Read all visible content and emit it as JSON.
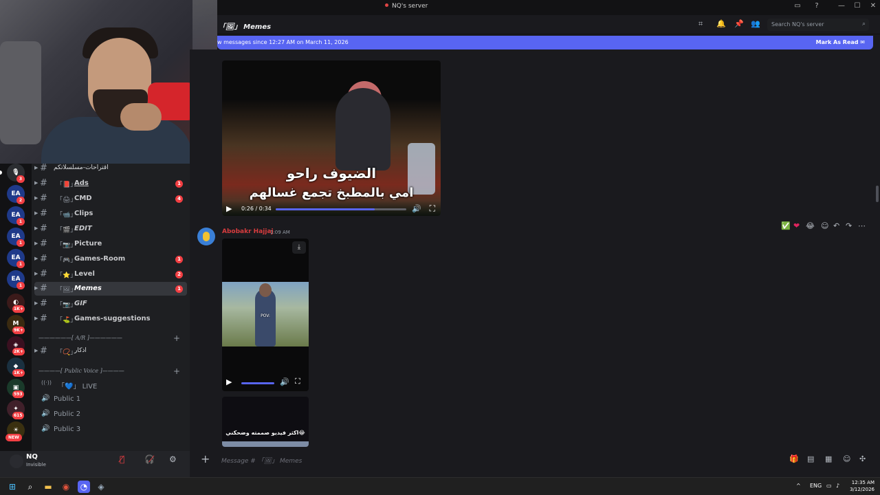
{
  "window": {
    "title": "NQ's server",
    "controls": [
      "—",
      "☐",
      "✕"
    ],
    "icons": [
      "screen-share-icon",
      "help-icon"
    ]
  },
  "servers": [
    {
      "label": "🎙",
      "badge": "3",
      "active": true
    },
    {
      "label": "EA",
      "badge": "2"
    },
    {
      "label": "EA",
      "badge": "1"
    },
    {
      "label": "EA",
      "badge": "1"
    },
    {
      "label": "EA",
      "badge": "1"
    },
    {
      "label": "EA",
      "badge": "1"
    },
    {
      "label": "◐",
      "badge": "1K+"
    },
    {
      "label": "M",
      "badge": "9K+"
    },
    {
      "label": "◈",
      "badge": "2K+"
    },
    {
      "label": "◆",
      "badge": "1K+"
    },
    {
      "label": "▣",
      "badge": "593"
    },
    {
      "label": "✦",
      "badge": "615"
    },
    {
      "label": "☀",
      "badge": "NEW"
    }
  ],
  "channels": [
    {
      "emoji": "",
      "name": "اقتراحات-مسلسلاتكم",
      "badge": "",
      "italic": false
    },
    {
      "emoji": "「📕」",
      "name": "Ads",
      "badge": "1",
      "italic": false
    },
    {
      "emoji": "「🖨」",
      "name": "CMD",
      "badge": "4",
      "italic": false
    },
    {
      "emoji": "「📹」",
      "name": "Clips",
      "badge": "",
      "italic": false
    },
    {
      "emoji": "「🎬」",
      "name": "EDIT",
      "badge": "",
      "italic": true
    },
    {
      "emoji": "「📷」",
      "name": "Picture",
      "badge": "",
      "italic": false
    },
    {
      "emoji": "「🎮」",
      "name": "Games-Room",
      "badge": "1",
      "italic": false
    },
    {
      "emoji": "「⭐」",
      "name": "Level",
      "badge": "2",
      "italic": false
    },
    {
      "emoji": "「🖼」",
      "name": "Memes",
      "badge": "1",
      "italic": true,
      "active": true
    },
    {
      "emoji": "「📷」",
      "name": "GIF",
      "badge": "",
      "italic": true
    },
    {
      "emoji": "「⛳」",
      "name": "Games-suggestions",
      "badge": "",
      "italic": false
    }
  ],
  "category_ajr": "——————[ A/R ]——————",
  "channel_adhkar": {
    "emoji": "「📿」",
    "name": "اذكار"
  },
  "category_voice": "————[ Public Voice ]————",
  "voice_channels": [
    {
      "icon": "((·))",
      "name": "「💙」 LIVE"
    },
    {
      "icon": "🔊",
      "name": "Public 1"
    },
    {
      "icon": "🔊",
      "name": "Public 2"
    },
    {
      "icon": "🔊",
      "name": "Public 3"
    }
  ],
  "user": {
    "name": "NQ",
    "status": "Invisible"
  },
  "header": {
    "channel": "「🖼」 Memes",
    "search_placeholder": "Search NQ's server",
    "icons": [
      "threads-icon",
      "bell-icon",
      "pin-icon",
      "members-icon"
    ]
  },
  "new_messages": {
    "text": "w messages since 12:27 AM on March 11, 2026",
    "action": "Mark As Read"
  },
  "video1": {
    "caption1": "الضيوف راحو",
    "caption2": "امي بالمطبخ تجمع غسالهم",
    "time": "0:26 / 0:34",
    "progress": 0.76
  },
  "message": {
    "author": "Abobakr Hajjaj",
    "time": "1:09 AM",
    "reactions": [
      "✅",
      "❤",
      "😂",
      "☺",
      "↶",
      "↷",
      "⋯"
    ]
  },
  "video2": {
    "caption": "POV:"
  },
  "video3": {
    "caption": "اكثر فيديو صممته وضحكني😂"
  },
  "input": {
    "placeholder": "Message # 「🖼」 Memes"
  },
  "taskbar": {
    "lang": "ENG",
    "time": "12:35 AM",
    "date": "3/12/2026"
  }
}
